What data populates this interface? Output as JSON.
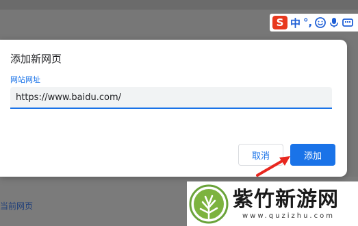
{
  "background": {
    "current_page_link": "当前网页"
  },
  "ime_toolbar": {
    "logo": "S",
    "mode": "中",
    "punct": "°,",
    "icons": [
      "emoji-icon",
      "microphone-icon",
      "keyboard-icon"
    ]
  },
  "dialog": {
    "title": "添加新网页",
    "url_label": "网站网址",
    "url_value": "https://www.baidu.com/",
    "cancel_label": "取消",
    "add_label": "添加"
  },
  "watermark": {
    "name": "紫竹新游网",
    "url": "www.quzizhu.com"
  },
  "colors": {
    "accent": "#1a73e8",
    "arrow": "#e8271f"
  }
}
